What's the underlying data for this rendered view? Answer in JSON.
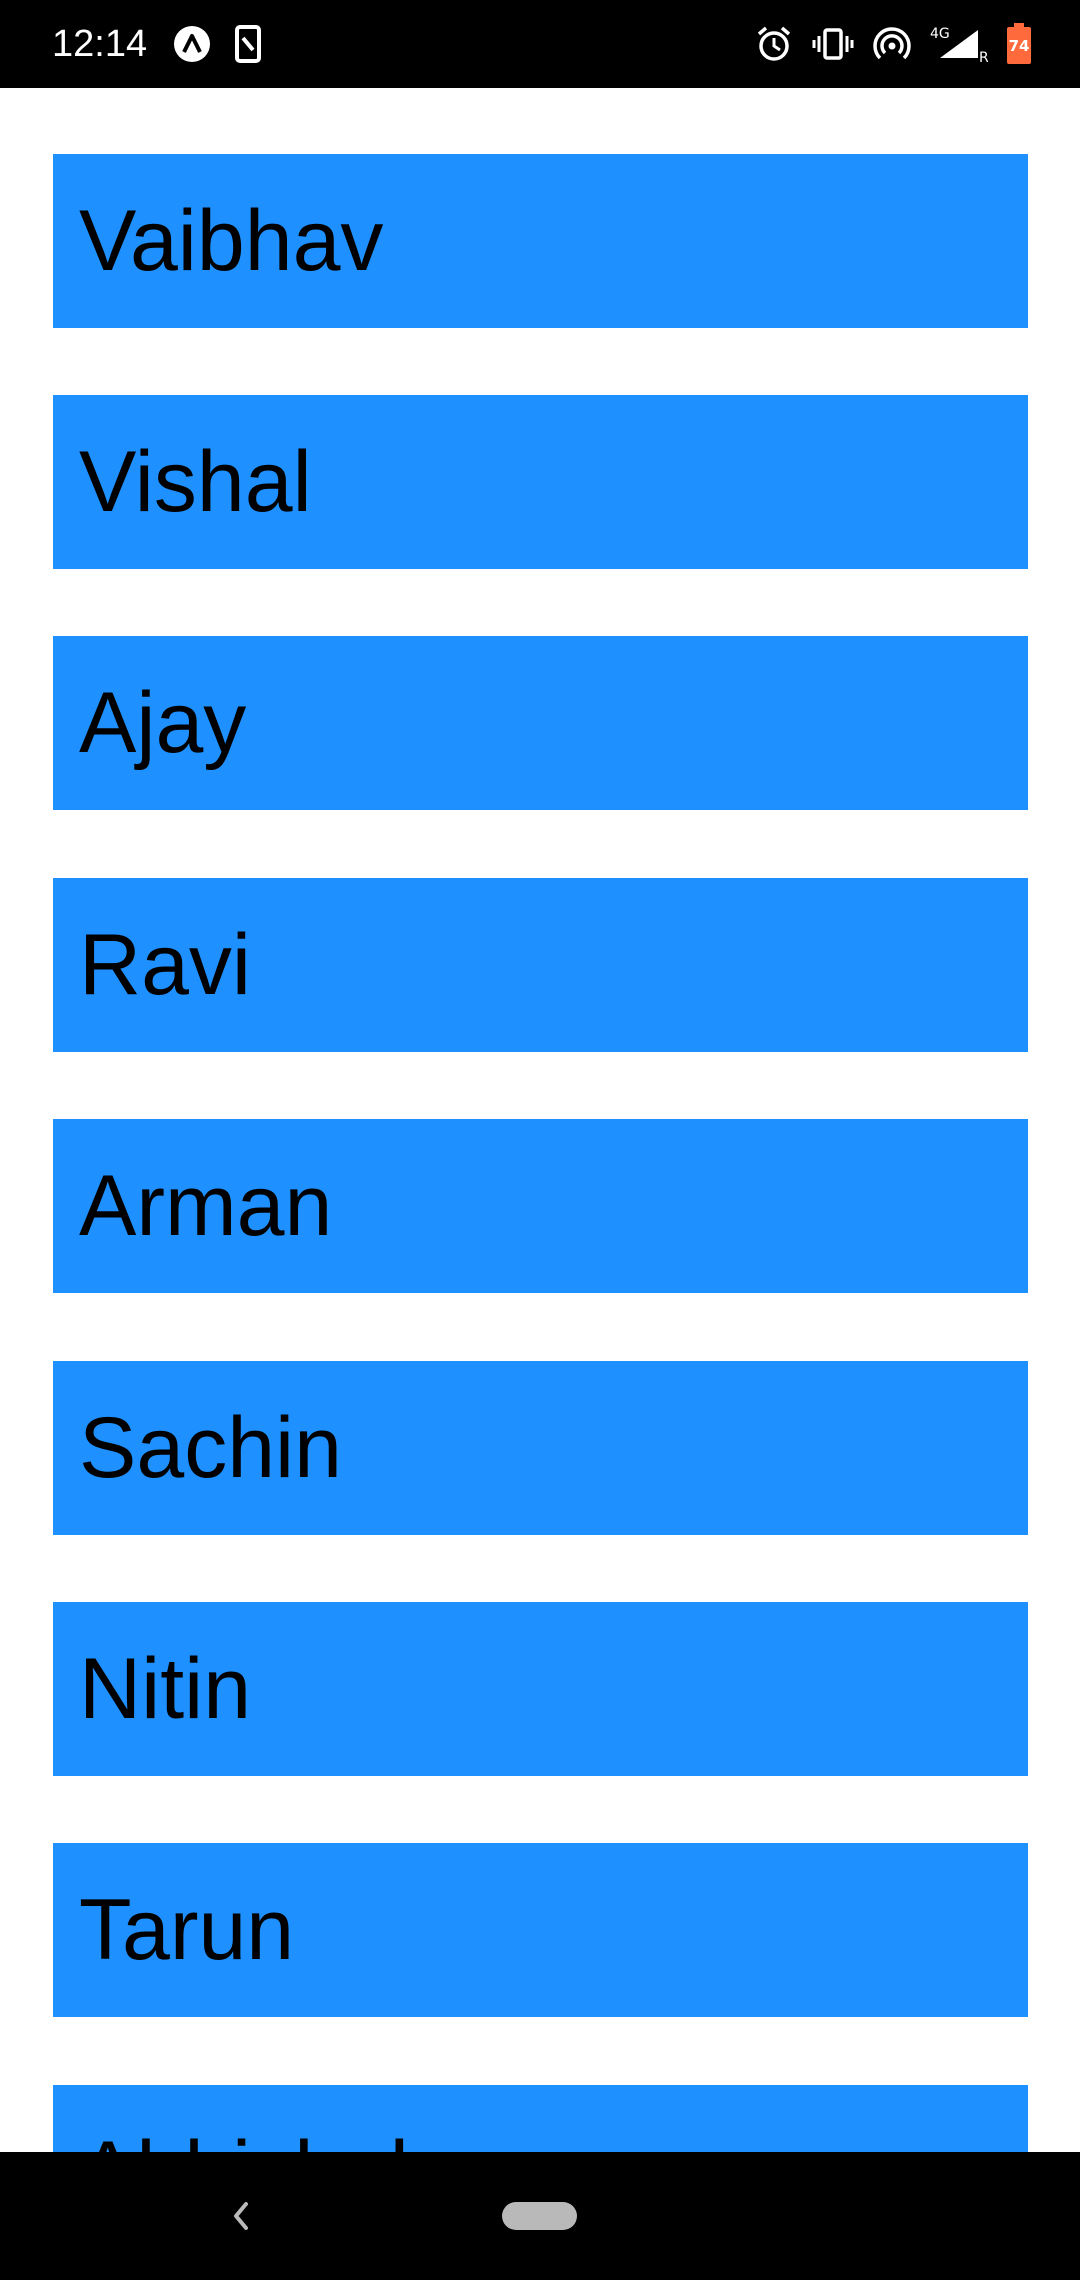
{
  "status_bar": {
    "time": "12:14",
    "battery_level": "74",
    "network_type": "4G",
    "roaming": "R",
    "left_icons": [
      "app-notification-icon",
      "sim-card-icon"
    ],
    "right_icons": [
      "alarm-icon",
      "vibrate-icon",
      "hotspot-icon",
      "signal-icon",
      "battery-icon"
    ]
  },
  "list": {
    "items": [
      {
        "label": "Vaibhav"
      },
      {
        "label": "Vishal"
      },
      {
        "label": "Ajay"
      },
      {
        "label": "Ravi"
      },
      {
        "label": "Arman"
      },
      {
        "label": "Sachin"
      },
      {
        "label": "Nitin"
      },
      {
        "label": "Tarun"
      },
      {
        "label": "Abhishek"
      }
    ]
  },
  "nav_bar": {
    "icons": [
      "back-icon",
      "home-pill-icon"
    ]
  },
  "colors": {
    "item_background": "#1e90ff",
    "item_text": "#000000",
    "bars": "#000000"
  }
}
